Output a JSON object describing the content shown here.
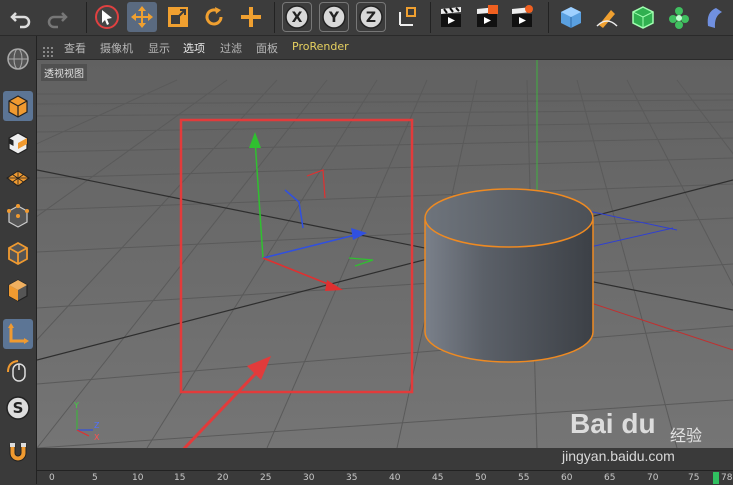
{
  "toolbar": {
    "items": [
      {
        "name": "undo-button",
        "icon": "undo-icon"
      },
      {
        "name": "redo-button",
        "icon": "redo-icon"
      },
      {
        "name": "select-tool-button",
        "icon": "cursor-icon"
      },
      {
        "name": "move-tool-button",
        "icon": "move-arrows-icon"
      },
      {
        "name": "scale-tool-button",
        "icon": "scale-icon"
      },
      {
        "name": "rotate-tool-button",
        "icon": "rotate-icon"
      },
      {
        "name": "add-tool-button",
        "icon": "plus-move-icon"
      },
      {
        "name": "x-axis-button",
        "label": "X"
      },
      {
        "name": "y-axis-button",
        "label": "Y"
      },
      {
        "name": "z-axis-button",
        "label": "Z"
      },
      {
        "name": "coordinate-system-button",
        "icon": "coordinate-icon"
      },
      {
        "name": "render-view-button",
        "icon": "clapperboard-icon"
      },
      {
        "name": "render-to-viewer-button",
        "icon": "clapperboard-render-icon"
      },
      {
        "name": "render-settings-button",
        "icon": "clapperboard-gear-icon"
      },
      {
        "name": "cube-button",
        "icon": "cube-icon"
      },
      {
        "name": "pen-button",
        "icon": "pen-icon"
      },
      {
        "name": "subdivision-button",
        "icon": "green-cube-icon"
      },
      {
        "name": "mograph-button",
        "icon": "cloner-icon"
      },
      {
        "name": "deformer-button",
        "icon": "bend-icon"
      }
    ],
    "axis_x": "X",
    "axis_y": "Y",
    "axis_z": "Z"
  },
  "menubar": {
    "items": [
      "查看",
      "摄像机",
      "显示",
      "选项",
      "过滤",
      "面板",
      "ProRender"
    ]
  },
  "viewport": {
    "label": "透视视图",
    "axis_labels": {
      "y": "Y",
      "z": "Z",
      "x": "X"
    }
  },
  "leftbar": {
    "items": [
      {
        "name": "make-editable-button",
        "icon": "globe-icon"
      },
      {
        "name": "model-mode-button",
        "icon": "cube-mode-icon"
      },
      {
        "name": "texture-mode-button",
        "icon": "checker-cube-icon"
      },
      {
        "name": "workplane-mode-button",
        "icon": "grid-plane-icon"
      },
      {
        "name": "points-mode-button",
        "icon": "points-cube-icon"
      },
      {
        "name": "edges-mode-button",
        "icon": "edges-cube-icon"
      },
      {
        "name": "polygons-mode-button",
        "icon": "polygon-cube-icon"
      },
      {
        "name": "axis-mode-button",
        "icon": "axis-icon"
      },
      {
        "name": "tweak-mode-button",
        "icon": "mouse-icon"
      },
      {
        "name": "snap-button",
        "icon": "snap-s-icon"
      },
      {
        "name": "magnet-button",
        "icon": "magnet-icon"
      }
    ]
  },
  "timeline": {
    "ticks": [
      "0",
      "5",
      "10",
      "15",
      "20",
      "25",
      "30",
      "35",
      "40",
      "45",
      "50",
      "55",
      "60",
      "65",
      "70",
      "75",
      "78"
    ]
  },
  "watermark": {
    "logo": "Bai du",
    "brand": "经验",
    "url": "jingyan.baidu.com"
  },
  "colors": {
    "accent": "#ee8a22",
    "selection_box": "#e23b3b",
    "x_axis": "#e03030",
    "y_axis": "#30c030",
    "z_axis": "#3050e0"
  }
}
